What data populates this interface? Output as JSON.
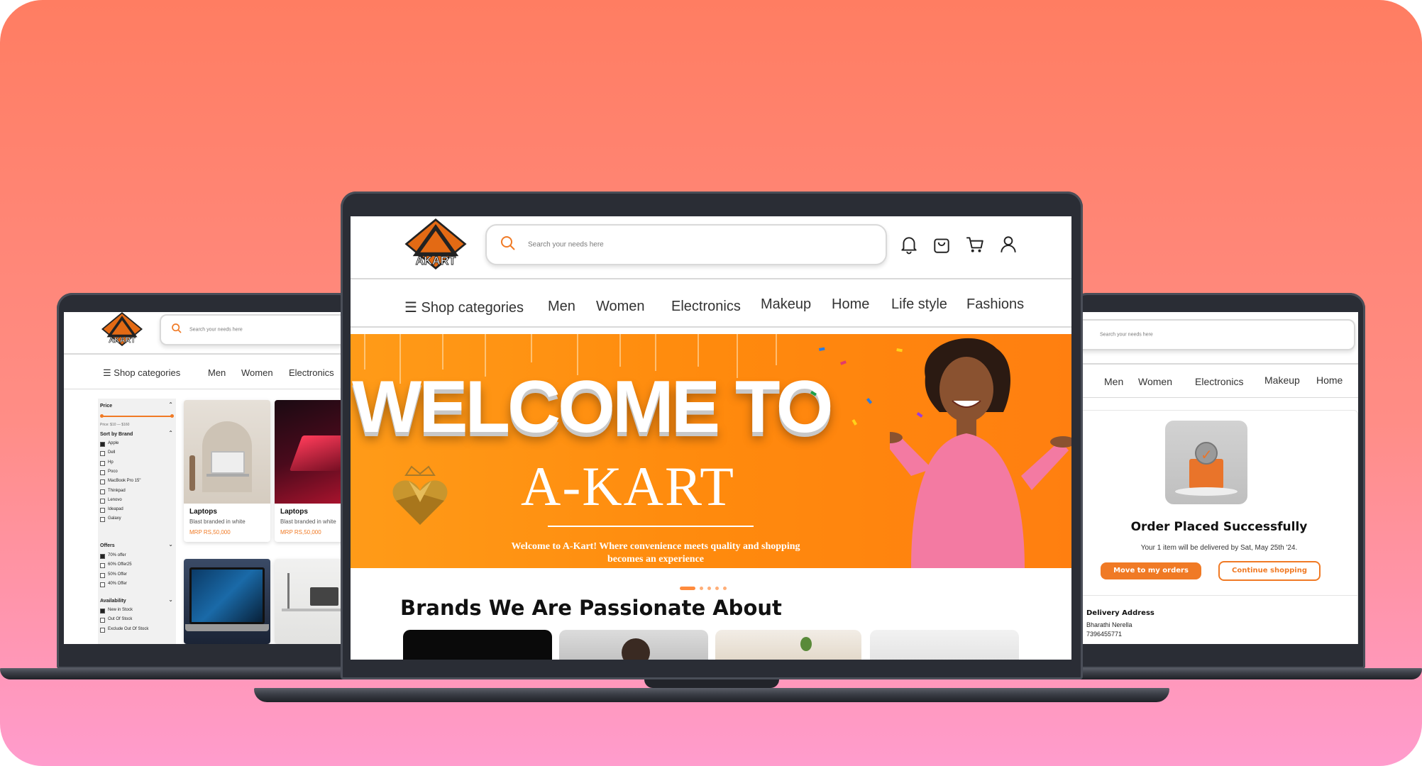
{
  "app": {
    "logo_text": "AKART",
    "search_placeholder": "Search your needs here",
    "brand_color": "#ff8a0d",
    "accent_color": "#f07a25"
  },
  "main": {
    "nav": {
      "categories_label": "Shop categories",
      "items": [
        "Men",
        "Women",
        "Electronics",
        "Makeup",
        "Home",
        "Life style",
        "Fashions"
      ]
    },
    "header_icons": [
      "bell-icon",
      "shopping-bag-icon",
      "cart-icon",
      "user-icon"
    ],
    "hero": {
      "welcome": "WELCOME TO",
      "brand": "A-KART",
      "tagline_line1": "Welcome to A-Kart! Where convenience meets quality and shopping",
      "tagline_line2": "becomes an experience",
      "carousel_pages": 5,
      "carousel_active": 1
    },
    "brands_title": "Brands We Are Passionate About"
  },
  "left": {
    "nav": {
      "categories_label": "Shop categories",
      "items": [
        "Men",
        "Women",
        "Electronics"
      ]
    },
    "filter": {
      "price_title": "Price",
      "price_range": "Price: $10 — $160",
      "brand_title": "Sort by Brand",
      "brands": [
        "Apple",
        "Dell",
        "Hp",
        "Poco",
        "MacBook Pro 15\"",
        "Thinkpad",
        "Lenovo",
        "Ideapad",
        "Galaxy"
      ],
      "brands_checked": [
        true,
        false,
        false,
        false,
        false,
        false,
        false,
        false,
        false
      ],
      "offers_title": "Offers",
      "offers": [
        "70% offer",
        "60% Offer25",
        "50% Offer",
        "40% Offer"
      ],
      "offers_checked": [
        true,
        false,
        false,
        false
      ],
      "availability_title": "Availability",
      "availability": [
        "New in Stock",
        "Out Of Stock",
        "Exclude Out Of Stock"
      ],
      "availability_checked": [
        true,
        false,
        false
      ]
    },
    "products": [
      {
        "title": "Laptops",
        "subtitle": "Blast branded in white",
        "price": "MRP RS,50,000"
      },
      {
        "title": "Laptops",
        "subtitle": "Blast branded in white",
        "price": "MRP RS,50,000"
      }
    ]
  },
  "right": {
    "nav": {
      "items": [
        "Men",
        "Women",
        "Electronics",
        "Makeup",
        "Home"
      ]
    },
    "order": {
      "title": "Order Placed Successfully",
      "message": "Your 1 item will be delivered by Sat, May 25th '24.",
      "primary_button": "Move to my orders",
      "secondary_button": "Continue shopping",
      "address_title": "Delivery Address",
      "name": "Bharathi Nerella",
      "phone": "7396455771"
    }
  }
}
